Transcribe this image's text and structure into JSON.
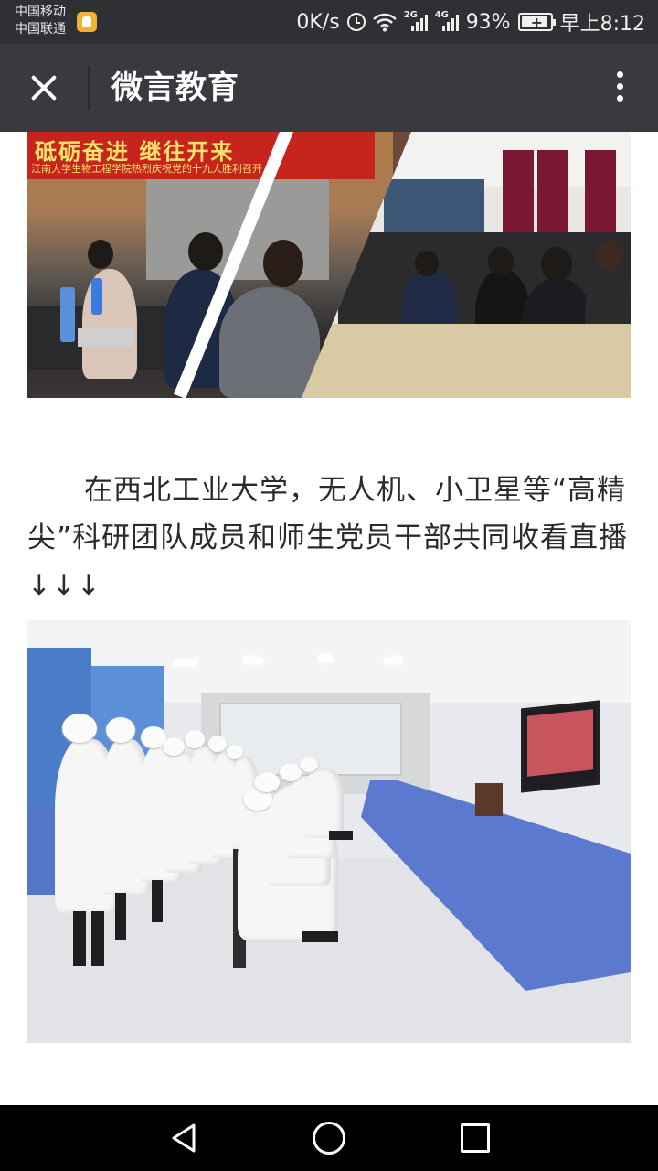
{
  "status_bar": {
    "carrier_1": "中国移动",
    "carrier_2": "中国联通",
    "net_speed": "0K/s",
    "signal_1_label": "2G",
    "signal_2_label": "4G",
    "battery": "93%",
    "battery_level": 0.93,
    "time": "早上8:12",
    "icons": [
      "app-notification-icon",
      "alarm-icon",
      "wifi-icon",
      "signal-icon",
      "battery-charging-icon"
    ]
  },
  "app_bar": {
    "title": "微言教育",
    "icons": [
      "close-icon",
      "more-vertical-icon"
    ]
  },
  "article": {
    "photo1": {
      "banner_main": "砥砺奋进  继往开来",
      "banner_sub": "江南大学生物工程学院热烈庆祝党的十九大胜利召开"
    },
    "paragraph": "在西北工业大学，无人机、小卫星等“高精尖”科研团队成员和师生党员干部共同收看直播↓↓↓"
  },
  "nav_bar": {
    "icons": [
      "back-icon",
      "home-icon",
      "recent-apps-icon"
    ]
  }
}
